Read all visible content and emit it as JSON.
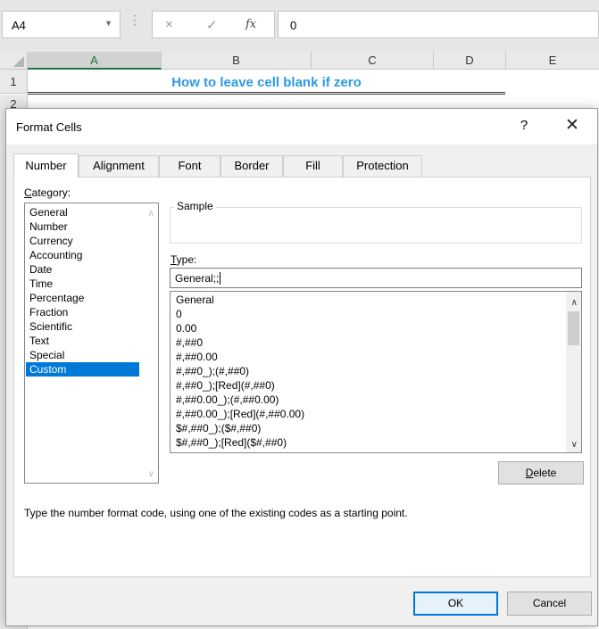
{
  "formula_bar": {
    "name_box": "A4",
    "cancel_icon": "×",
    "enter_icon": "✓",
    "fx_icon": "fx",
    "value": "0"
  },
  "sheet": {
    "columns": [
      "A",
      "B",
      "C",
      "D",
      "E"
    ],
    "rows": [
      "1",
      "2"
    ],
    "title_cell": "How to leave cell blank if zero",
    "title_color": "#2e9be0",
    "selected_column_color": "#217346"
  },
  "dialog": {
    "title": "Format Cells",
    "help": "?",
    "close": "✕",
    "tabs": [
      "Number",
      "Alignment",
      "Font",
      "Border",
      "Fill",
      "Protection"
    ],
    "active_tab": "Number",
    "category_label_first": "C",
    "category_label_rest": "ategory:",
    "categories": [
      "General",
      "Number",
      "Currency",
      "Accounting",
      "Date",
      "Time",
      "Percentage",
      "Fraction",
      "Scientific",
      "Text",
      "Special",
      "Custom"
    ],
    "selected_category": "Custom",
    "sample_label": "Sample",
    "type_label_first": "T",
    "type_label_rest": "ype:",
    "type_value": "General;;",
    "formats": [
      "General",
      "0",
      "0.00",
      "#,##0",
      "#,##0.00",
      "#,##0_);(#,##0)",
      "#,##0_);[Red](#,##0)",
      "#,##0.00_);(#,##0.00)",
      "#,##0.00_);[Red](#,##0.00)",
      "$#,##0_);($#,##0)",
      "$#,##0_);[Red]($#,##0)"
    ],
    "delete_first": "D",
    "delete_rest": "elete",
    "hint": "Type the number format code, using one of the existing codes as a starting point.",
    "ok": "OK",
    "cancel": "Cancel",
    "accent_color": "#0078d7"
  }
}
